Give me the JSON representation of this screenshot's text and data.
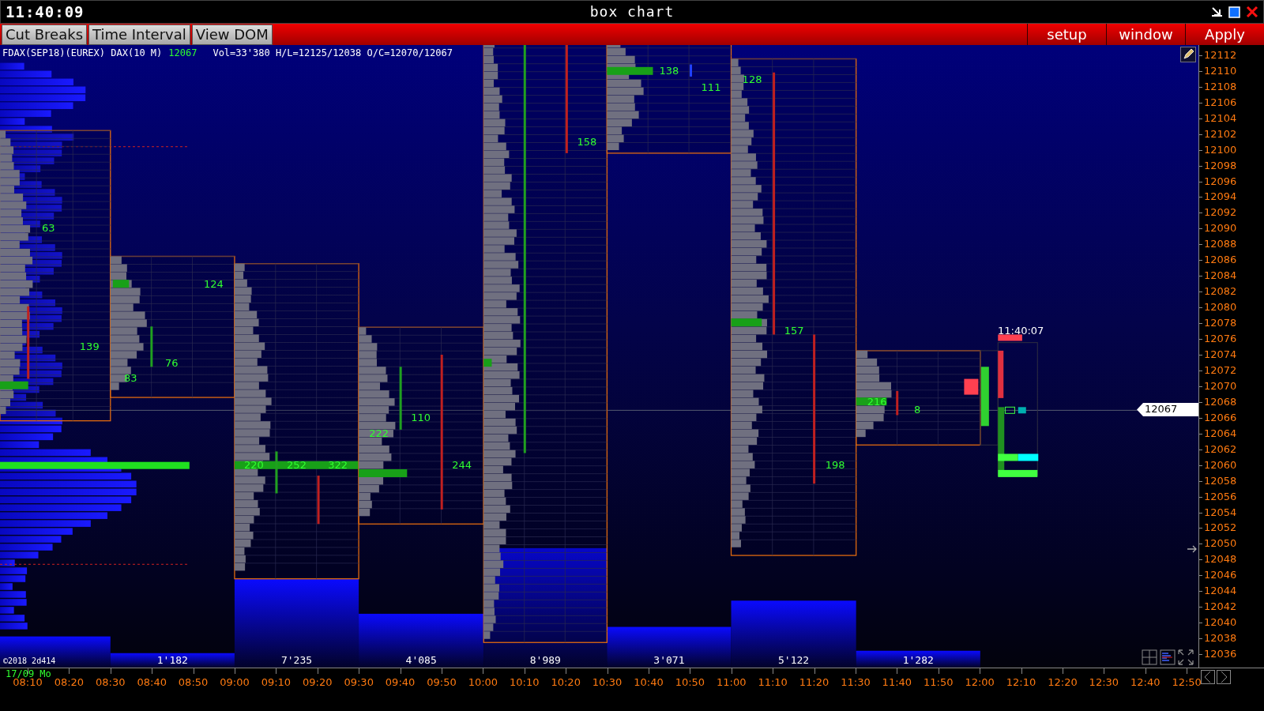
{
  "window": {
    "clock": "11:40:09",
    "title": "box chart"
  },
  "toolbar": {
    "left_buttons": [
      "Cut Breaks",
      "Time Interval",
      "View DOM"
    ],
    "right_buttons": [
      "setup",
      "window",
      "Apply"
    ]
  },
  "chart": {
    "symbol": "FDAX(SEP18)(EUREX) DAX(10 M)",
    "last": "12067",
    "stats": "Vol=33'380 H/L=12125/12038 O/C=12070/12067",
    "current_time": "11:40:07",
    "current_price": "12067",
    "copyright": "©2018 2d414",
    "sessions": [
      {
        "poc_values": [
          "63",
          "139"
        ]
      },
      {
        "volume": "1'182",
        "poc_values": [
          "124",
          "76",
          "83"
        ]
      },
      {
        "volume": "7'235",
        "poc_values": [
          "220",
          "252",
          "322"
        ]
      },
      {
        "volume": "4'085",
        "poc_values": [
          "222",
          "110",
          "244"
        ]
      },
      {
        "volume": "8'989",
        "poc_values": [
          "158"
        ]
      },
      {
        "volume": "3'071",
        "poc_values": [
          "138",
          "111"
        ]
      },
      {
        "volume": "5'122",
        "poc_values": [
          "128",
          "157",
          "198"
        ]
      },
      {
        "volume": "1'282",
        "poc_values": [
          "216",
          "8"
        ]
      }
    ],
    "price_labels": [
      "12112",
      "12110",
      "12108",
      "12106",
      "12104",
      "12102",
      "12100",
      "12098",
      "12096",
      "12094",
      "12092",
      "12090",
      "12088",
      "12086",
      "12084",
      "12082",
      "12080",
      "12078",
      "12076",
      "12074",
      "12072",
      "12070",
      "12068",
      "12066",
      "12064",
      "12062",
      "12060",
      "12058",
      "12056",
      "12054",
      "12052",
      "12050",
      "12048",
      "12046",
      "12044",
      "12042",
      "12040",
      "12038",
      "12036"
    ],
    "date": "17/09 Mo",
    "time_labels": [
      "08:10",
      "08:20",
      "08:30",
      "08:40",
      "08:50",
      "09:00",
      "09:10",
      "09:20",
      "09:30",
      "09:40",
      "09:50",
      "10:00",
      "10:10",
      "10:20",
      "10:30",
      "10:40",
      "10:50",
      "11:00",
      "11:10",
      "11:20",
      "11:30",
      "11:40",
      "11:50",
      "12:00",
      "12:10",
      "12:20",
      "12:30",
      "12:40",
      "12:50"
    ]
  }
}
